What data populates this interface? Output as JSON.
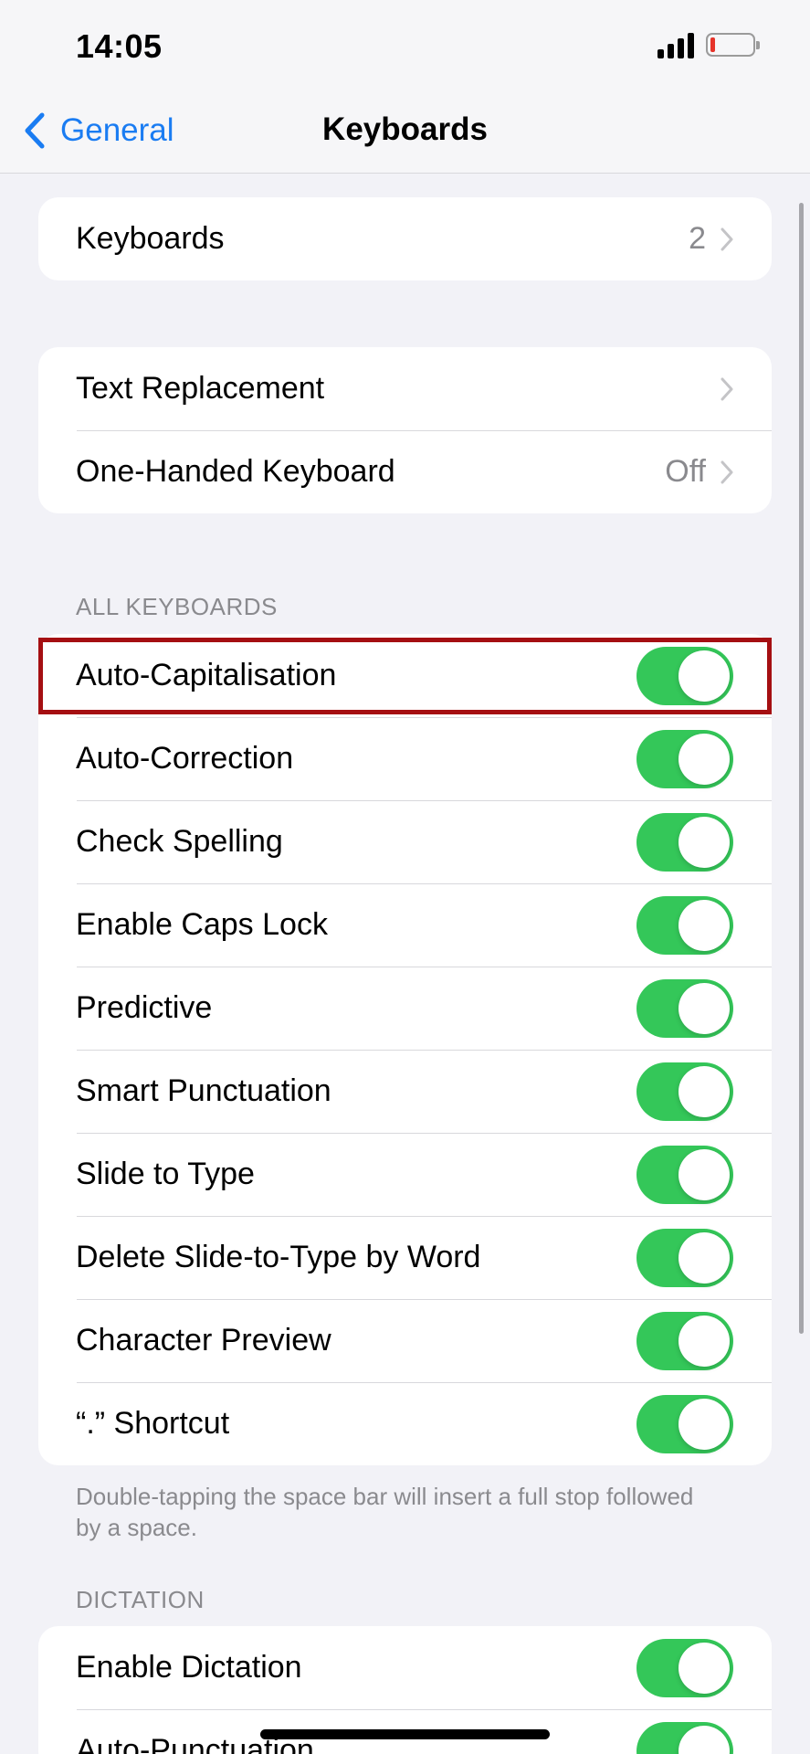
{
  "status_bar": {
    "time": "14:05"
  },
  "nav": {
    "back_label": "General",
    "title": "Keyboards"
  },
  "group1": [
    {
      "label": "Keyboards",
      "value": "2"
    }
  ],
  "group2": [
    {
      "label": "Text Replacement",
      "value": ""
    },
    {
      "label": "One-Handed Keyboard",
      "value": "Off"
    }
  ],
  "all_keyboards": {
    "header": "ALL KEYBOARDS",
    "items": [
      {
        "label": "Auto-Capitalisation",
        "on": true
      },
      {
        "label": "Auto-Correction",
        "on": true
      },
      {
        "label": "Check Spelling",
        "on": true
      },
      {
        "label": "Enable Caps Lock",
        "on": true
      },
      {
        "label": "Predictive",
        "on": true
      },
      {
        "label": "Smart Punctuation",
        "on": true
      },
      {
        "label": "Slide to Type",
        "on": true
      },
      {
        "label": "Delete Slide-to-Type by Word",
        "on": true
      },
      {
        "label": "Character Preview",
        "on": true
      },
      {
        "label": "“.” Shortcut",
        "on": true
      }
    ],
    "footer": "Double-tapping the space bar will insert a full stop followed by a space."
  },
  "dictation": {
    "header": "DICTATION",
    "items": [
      {
        "label": "Enable Dictation",
        "on": true
      },
      {
        "label": "Auto-Punctuation",
        "on": true
      }
    ]
  },
  "colors": {
    "accent": "#1a7cf2",
    "toggle_on": "#34c759",
    "highlight": "#a50f12"
  }
}
